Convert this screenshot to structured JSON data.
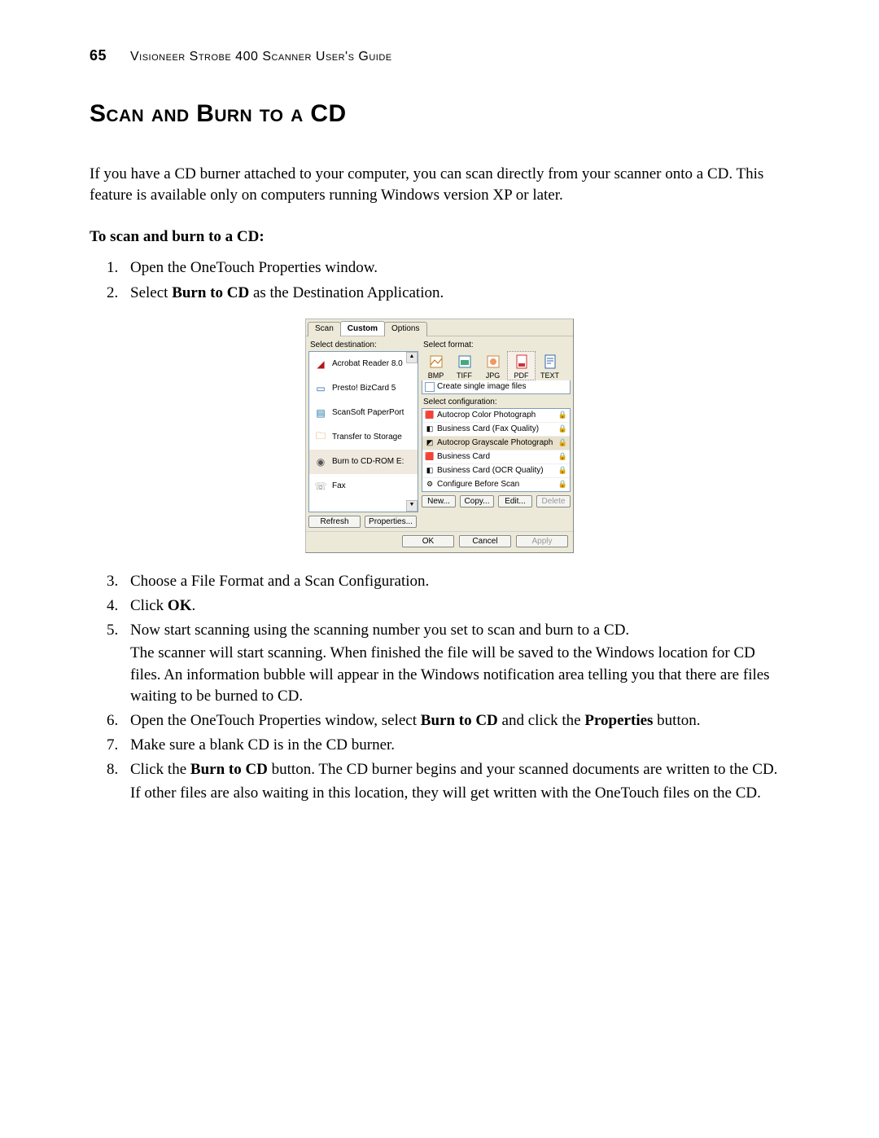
{
  "header": {
    "page_number": "65",
    "guide_title": "Visioneer Strobe 400 Scanner User's Guide"
  },
  "section_title": "Scan and Burn to a CD",
  "intro": "If you have a CD burner attached to your computer, you can scan directly from your scanner onto a CD. This feature is available only on computers running Windows version XP or later.",
  "subhead": "To scan and burn to a CD:",
  "steps_top": {
    "s1": "Open the OneTouch Properties window.",
    "s2_pre": "Select ",
    "s2_bold": "Burn to CD",
    "s2_post": " as the Destination Application."
  },
  "steps_bottom": {
    "s3": "Choose a File Format and a Scan Configuration.",
    "s4_pre": "Click ",
    "s4_bold": "OK",
    "s4_post": ".",
    "s5_a": "Now start scanning using the scanning number you set to scan and burn to a CD.",
    "s5_b": "The scanner will start scanning. When finished the file will be saved to the Windows location for CD files. An information bubble will appear in the Windows notification area telling you that there are files waiting to be burned to CD.",
    "s6_pre": "Open the OneTouch Properties window, select ",
    "s6_b1": "Burn to CD",
    "s6_mid": " and click the ",
    "s6_b2": "Properties",
    "s6_post": " button.",
    "s7": "Make sure a blank CD is in the CD burner.",
    "s8a_pre": "Click the ",
    "s8a_b": "Burn to CD",
    "s8a_post": " button. The CD burner begins and your scanned documents are written to the CD.",
    "s8b": "If other files are also waiting in this location, they will get written with the OneTouch files on the CD."
  },
  "dialog": {
    "tabs": {
      "scan": "Scan",
      "custom": "Custom",
      "options": "Options"
    },
    "select_destination": "Select destination:",
    "destinations": {
      "d0": "Acrobat Reader 8.0",
      "d1": "Presto! BizCard 5",
      "d2": "ScanSoft PaperPort",
      "d3": "Transfer to Storage",
      "d4": "Burn to CD-ROM  E:",
      "d5": "Fax"
    },
    "refresh": "Refresh",
    "properties": "Properties...",
    "select_format": "Select format:",
    "formats": {
      "bmp": "BMP",
      "tiff": "TIFF",
      "jpg": "JPG",
      "pdf": "PDF",
      "text": "TEXT"
    },
    "create_single": "Create single image files",
    "select_config": "Select configuration:",
    "configs": {
      "c0": "Autocrop Color Photograph",
      "c1": "Business Card (Fax Quality)",
      "c2": "Autocrop Grayscale Photograph",
      "c3": "Business Card",
      "c4": "Business Card (OCR Quality)",
      "c5": "Configure Before Scan"
    },
    "new": "New...",
    "copy": "Copy...",
    "edit": "Edit...",
    "delete": "Delete",
    "ok": "OK",
    "cancel": "Cancel",
    "apply": "Apply"
  }
}
